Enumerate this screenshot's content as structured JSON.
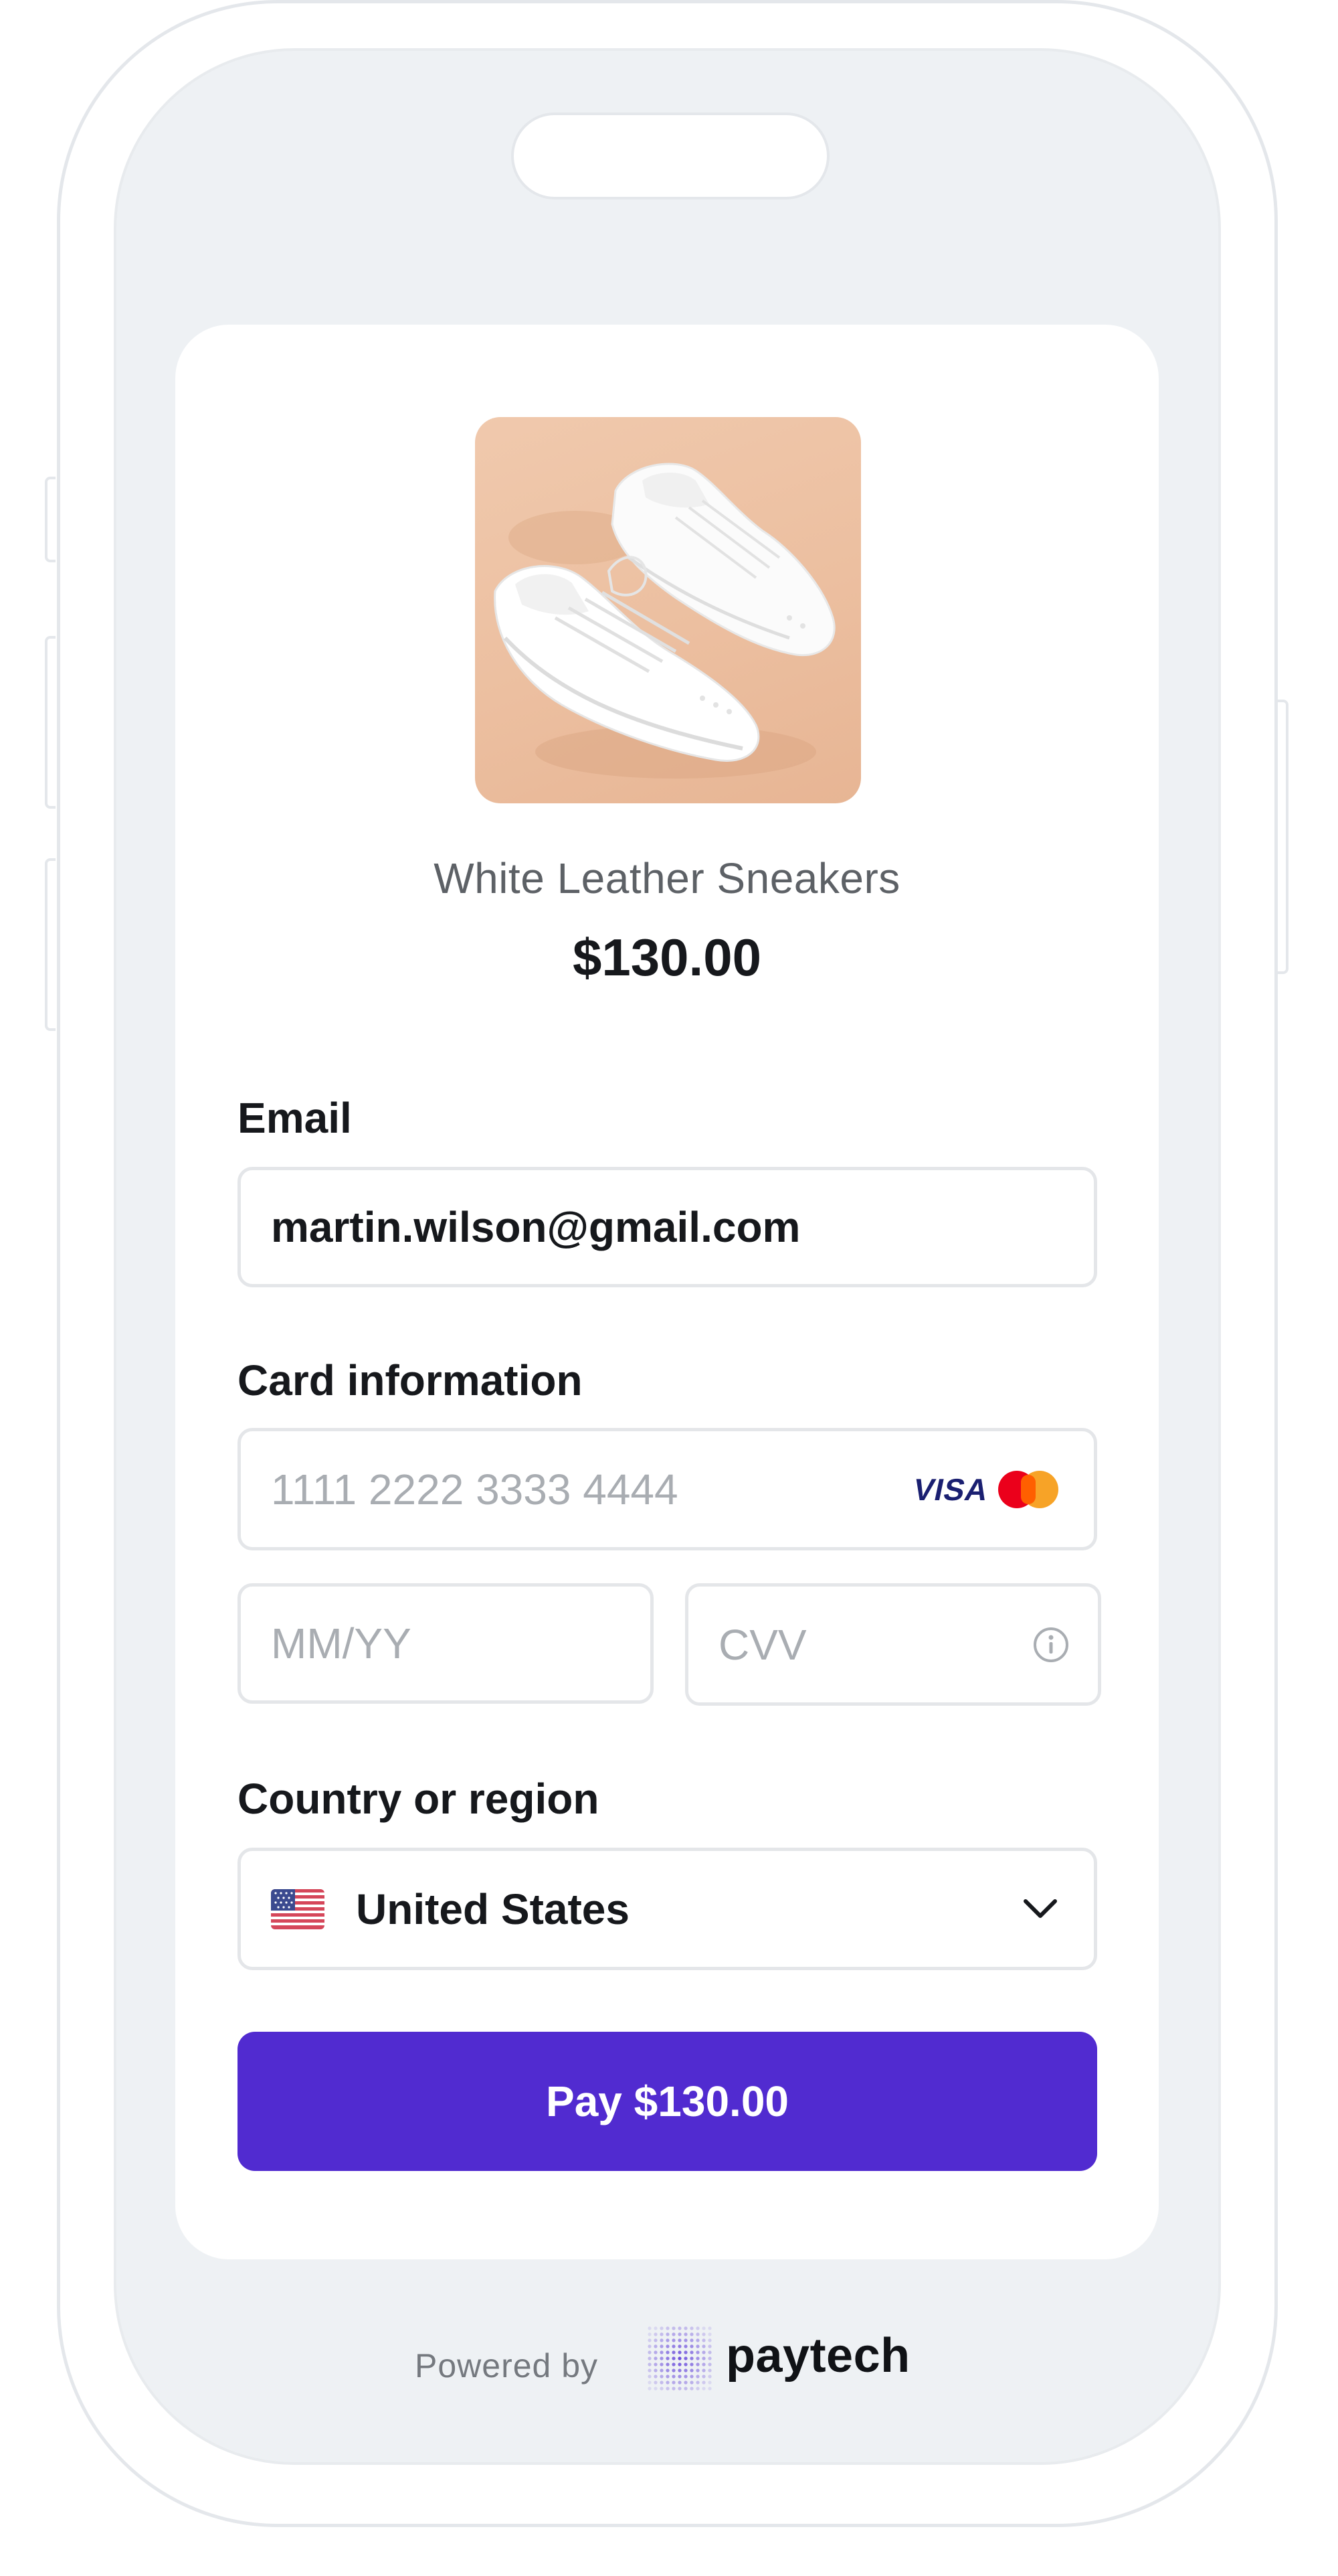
{
  "product": {
    "name": "White Leather Sneakers",
    "price": "$130.00"
  },
  "form": {
    "email_label": "Email",
    "email_value": "martin.wilson@gmail.com",
    "card_label": "Card information",
    "card_number_placeholder": "1111 2222 3333 4444",
    "card_brand_visa": "VISA",
    "expiry_placeholder": "MM/YY",
    "cvv_placeholder": "CVV",
    "country_label": "Country or region",
    "country_value": "United States"
  },
  "pay_button": {
    "label": "Pay $130.00",
    "color": "#512bd0"
  },
  "footer": {
    "powered_by": "Powered by",
    "brand": "paytech"
  },
  "icons": {
    "visa": "visa-logo-icon",
    "mastercard": "mastercard-logo-icon",
    "info": "info-icon",
    "flag": "us-flag-icon",
    "chevron": "chevron-down-icon",
    "paytech_logo": "paytech-logo-icon"
  }
}
